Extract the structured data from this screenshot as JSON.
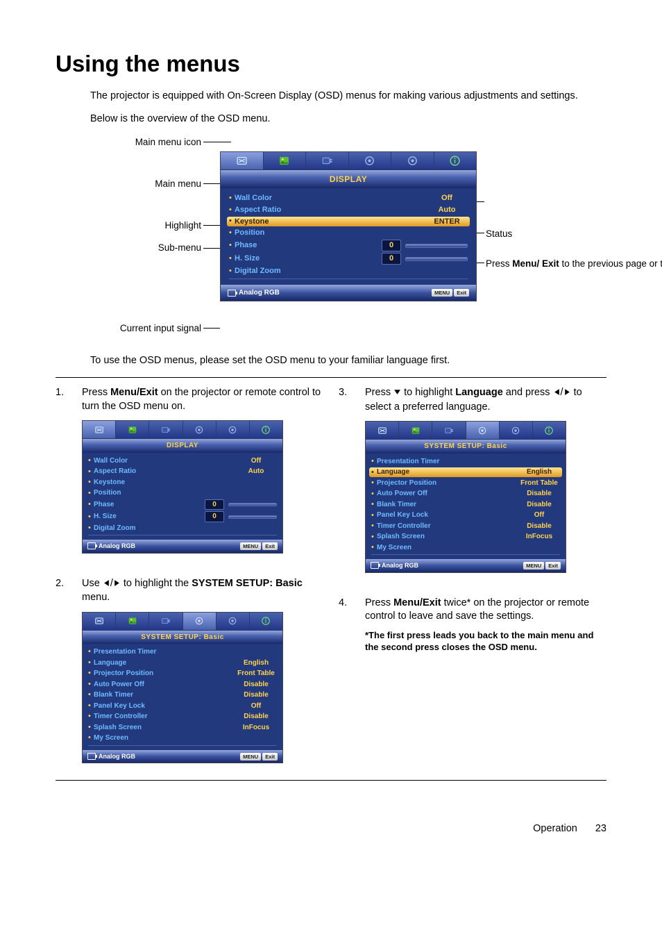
{
  "title": "Using the menus",
  "intro1": "The projector is equipped with On-Screen Display (OSD) menus for making various adjustments and settings.",
  "intro2": "Below is the overview of the OSD menu.",
  "labels": {
    "mainMenuIcon": "Main menu icon",
    "mainMenu": "Main menu",
    "highlight": "Highlight",
    "subMenu": "Sub-menu",
    "currentInput": "Current input signal",
    "status": "Status",
    "menuExitNote_a": "Press ",
    "menuExitNote_b": "Menu/ Exit",
    "menuExitNote_c": " to the previous page or to exit."
  },
  "osdMain": {
    "title": "DISPLAY",
    "items": [
      {
        "label": "Wall Color",
        "value": "Off",
        "slider": false,
        "hl": false
      },
      {
        "label": "Aspect Ratio",
        "value": "Auto",
        "slider": false,
        "hl": false
      },
      {
        "label": "Keystone",
        "value": "ENTER",
        "slider": false,
        "hl": true
      },
      {
        "label": "Position",
        "value": "",
        "slider": false,
        "hl": false
      },
      {
        "label": "Phase",
        "value": "0",
        "slider": true,
        "hl": false
      },
      {
        "label": "H. Size",
        "value": "0",
        "slider": true,
        "hl": false
      },
      {
        "label": "Digital Zoom",
        "value": "",
        "slider": false,
        "hl": false
      }
    ],
    "signal": "Analog RGB",
    "footerBtns": [
      "MENU",
      "Exit"
    ]
  },
  "intro3": "To use the OSD menus, please set the OSD menu to your familiar language first.",
  "step1": {
    "num": "1.",
    "pre": "Press ",
    "bold": "Menu/Exit",
    "post": " on the projector or remote control to turn the OSD menu on."
  },
  "osdStep1": {
    "title": "DISPLAY",
    "items": [
      {
        "label": "Wall Color",
        "value": "Off",
        "slider": false
      },
      {
        "label": "Aspect Ratio",
        "value": "Auto",
        "slider": false
      },
      {
        "label": "Keystone",
        "value": "",
        "slider": false
      },
      {
        "label": "Position",
        "value": "",
        "slider": false
      },
      {
        "label": "Phase",
        "value": "0",
        "slider": true
      },
      {
        "label": "H. Size",
        "value": "0",
        "slider": true
      },
      {
        "label": "Digital Zoom",
        "value": "",
        "slider": false
      }
    ],
    "signal": "Analog RGB",
    "footerBtns": [
      "MENU",
      "Exit"
    ]
  },
  "step2": {
    "num": "2.",
    "text_a": "Use ",
    "text_b": " to highlight the ",
    "bold": "SYSTEM SETUP: Basic",
    "text_c": " menu."
  },
  "osdStep2": {
    "title": "SYSTEM SETUP: Basic",
    "items": [
      {
        "label": "Presentation Timer",
        "value": ""
      },
      {
        "label": "Language",
        "value": "English"
      },
      {
        "label": "Projector Position",
        "value": "Front Table"
      },
      {
        "label": "Auto Power Off",
        "value": "Disable"
      },
      {
        "label": "Blank Timer",
        "value": "Disable"
      },
      {
        "label": "Panel Key Lock",
        "value": "Off"
      },
      {
        "label": "Timer Controller",
        "value": "Disable"
      },
      {
        "label": "Splash Screen",
        "value": "InFocus"
      },
      {
        "label": "My Screen",
        "value": ""
      }
    ],
    "signal": "Analog RGB",
    "footerBtns": [
      "MENU",
      "Exit"
    ]
  },
  "step3": {
    "num": "3.",
    "text_a": "Press ",
    "text_b": " to highlight ",
    "bold": "Language",
    "text_c": " and press ",
    "text_d": " to select a preferred language."
  },
  "osdStep3": {
    "title": "SYSTEM SETUP: Basic",
    "items": [
      {
        "label": "Presentation Timer",
        "value": "",
        "hl": false
      },
      {
        "label": "Language",
        "value": "English",
        "hl": true
      },
      {
        "label": "Projector Position",
        "value": "Front Table",
        "hl": false
      },
      {
        "label": "Auto Power Off",
        "value": "Disable",
        "hl": false
      },
      {
        "label": "Blank Timer",
        "value": "Disable",
        "hl": false
      },
      {
        "label": "Panel Key Lock",
        "value": "Off",
        "hl": false
      },
      {
        "label": "Timer Controller",
        "value": "Disable",
        "hl": false
      },
      {
        "label": "Splash Screen",
        "value": "InFocus",
        "hl": false
      },
      {
        "label": "My Screen",
        "value": "",
        "hl": false
      }
    ],
    "signal": "Analog RGB",
    "footerBtns": [
      "MENU",
      "Exit"
    ]
  },
  "step4": {
    "num": "4.",
    "text_a": "Press ",
    "bold": "Menu/Exit",
    "text_b": " twice* on the projector or remote control to leave and save the settings."
  },
  "step4note": "*The first press leads you back to the main menu and the second press closes the OSD menu.",
  "footer": {
    "section": "Operation",
    "page": "23"
  }
}
